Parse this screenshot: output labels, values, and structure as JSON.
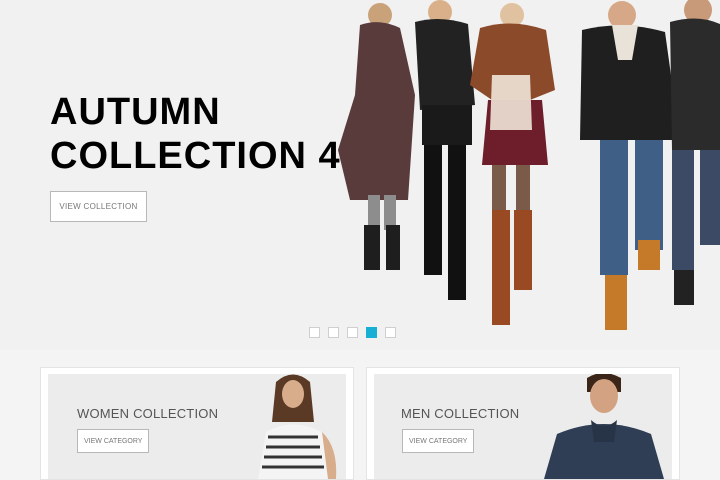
{
  "hero": {
    "headline_line1": "AUTUMN",
    "headline_line2": "COLLECTION 4",
    "cta_label": "VIEW COLLECTION"
  },
  "slider": {
    "total_slides": 5,
    "active_slide": 4,
    "active_color": "#17b0d4"
  },
  "categories": [
    {
      "title": "WOMEN COLLECTION",
      "cta_label": "VIEW CATEGORY"
    },
    {
      "title": "MEN COLLECTION",
      "cta_label": "VIEW CATEGORY"
    }
  ]
}
